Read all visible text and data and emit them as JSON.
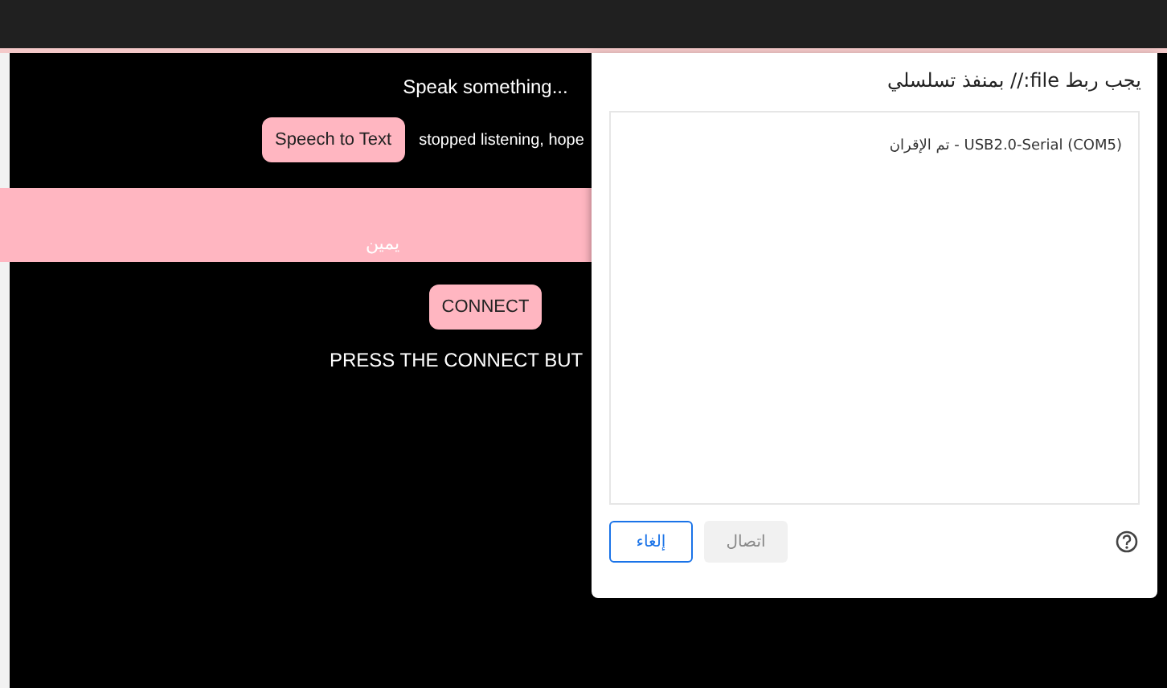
{
  "page": {
    "prompt": "Speak something...",
    "speech_button": "Speech to Text",
    "status": "stopped listening, hope",
    "direction_label": "يمين",
    "connect_button": "CONNECT",
    "instruction": "PRESS THE CONNECT BUT"
  },
  "dialog": {
    "title": "يجب ربط file:// بمنفذ تسلسلي",
    "devices": [
      {
        "label": "USB2.0-Serial (COM5) - تم الإقران",
        "selected": false
      }
    ],
    "buttons": [
      {
        "label": "اتصال",
        "kind": "secondary",
        "disabled": true
      },
      {
        "label": "إلغاء",
        "kind": "primary",
        "disabled": false
      }
    ]
  }
}
